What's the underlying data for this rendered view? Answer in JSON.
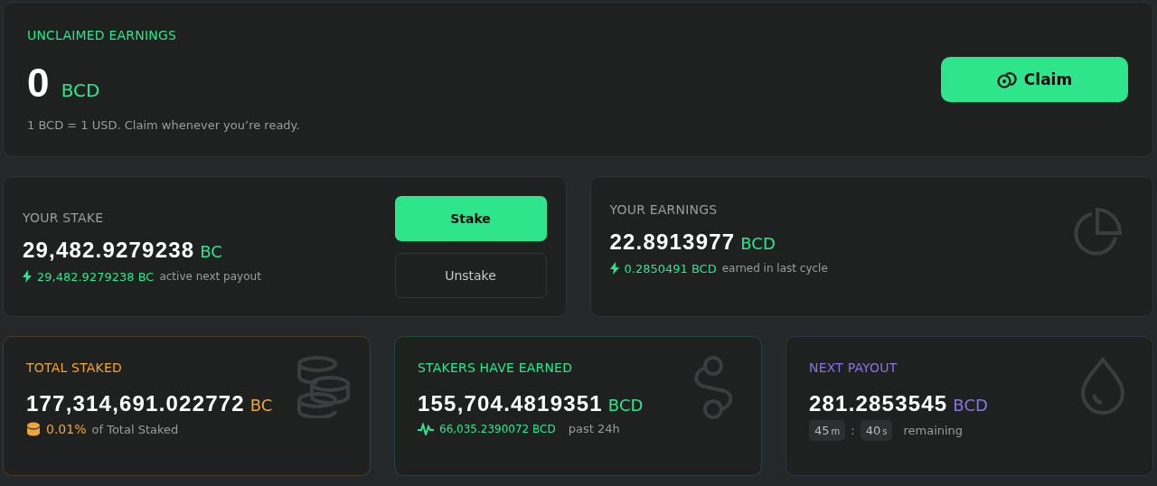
{
  "unclaimed": {
    "label": "UNCLAIMED EARNINGS",
    "amount": "0",
    "unit": "BCD",
    "note": "1 BCD = 1 USD. Claim whenever you’re ready.",
    "claim_button": "Claim"
  },
  "stake": {
    "label": "YOUR STAKE",
    "amount": "29,482.9279238",
    "unit": "BC",
    "active_amount": "29,482.9279238 BC",
    "active_note": "active next payout",
    "buttons": [
      {
        "label": "Stake",
        "kind": "primary"
      },
      {
        "label": "Unstake",
        "kind": "secondary"
      }
    ]
  },
  "earnings": {
    "label": "YOUR EARNINGS",
    "amount": "22.8913977",
    "unit": "BCD",
    "cycle_amount": "0.2850491 BCD",
    "cycle_note": "earned in last cycle"
  },
  "stats": [
    {
      "kind": "total",
      "label": "TOTAL STAKED",
      "amount": "177,314,691.022772",
      "unit": "BC",
      "color": "#f0a53a",
      "percent": "0.01%",
      "percent_note": "of Total Staked"
    },
    {
      "kind": "earned",
      "label": "STAKERS HAVE EARNED",
      "amount": "155,704.4819351",
      "unit": "BCD",
      "color": "#2fe58c",
      "day_amount": "66,035.2390072 BCD",
      "day_note": "past 24h"
    },
    {
      "kind": "payout",
      "label": "NEXT PAYOUT",
      "amount": "281.2853545",
      "unit": "BCD",
      "color": "#8c72e4",
      "minutes": "45",
      "minutes_unit": "m",
      "separator": ":",
      "seconds": "40",
      "seconds_unit": "s",
      "remaining": "remaining"
    }
  ]
}
